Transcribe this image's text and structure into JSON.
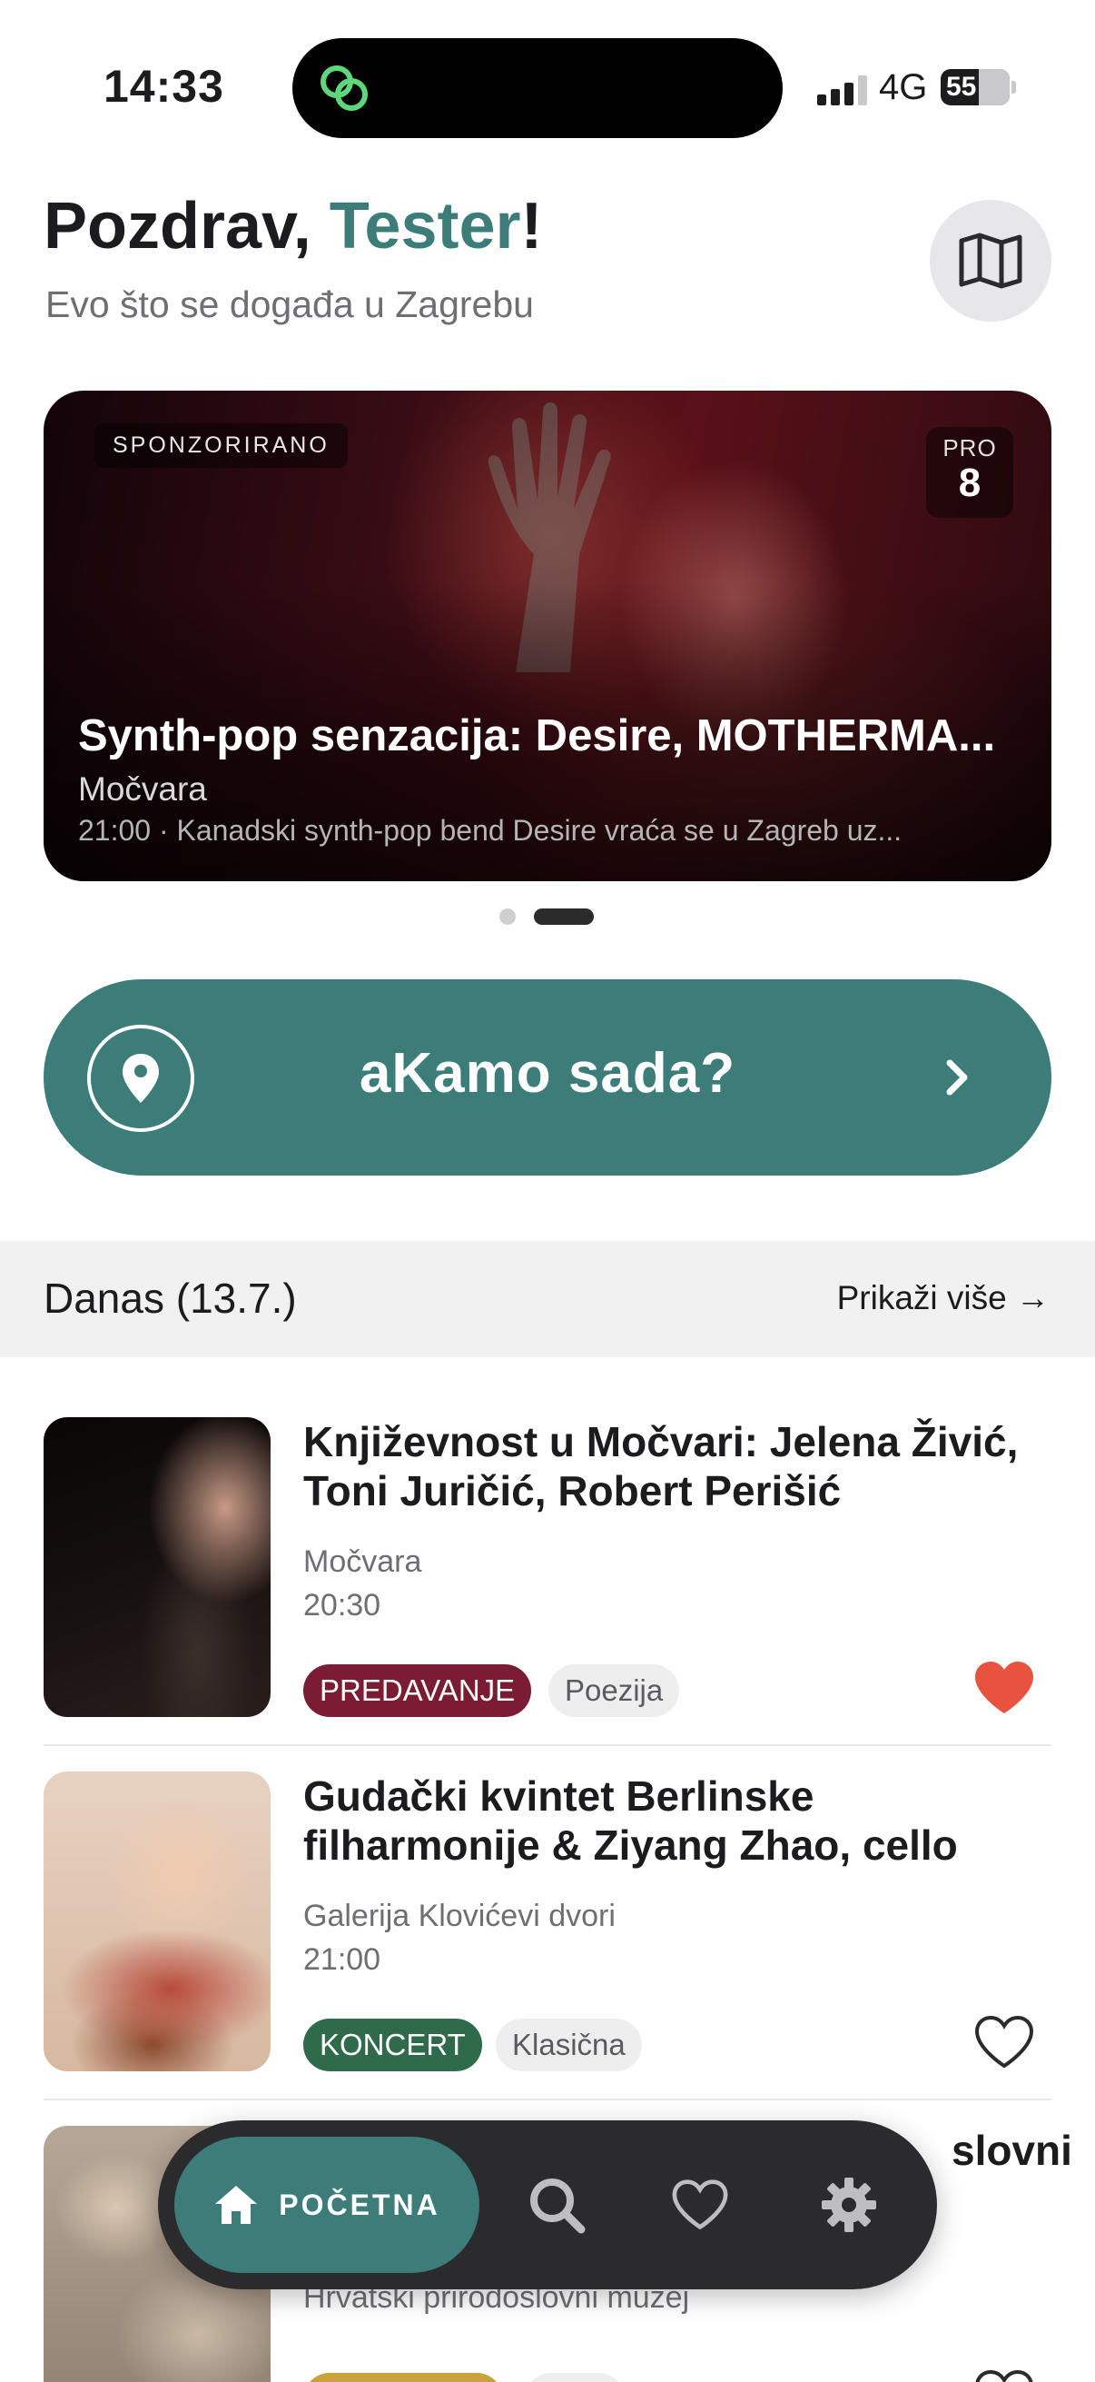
{
  "status_bar": {
    "time": "14:33",
    "network": "4G",
    "battery": "55"
  },
  "header": {
    "greeting_prefix": "Pozdrav, ",
    "user_name": "Tester",
    "greeting_suffix": "!",
    "subtitle": "Evo što se događa u Zagrebu",
    "map_icon": "map-icon"
  },
  "promo": {
    "tag": "SPONZORIRANO",
    "month": "PRO",
    "day": "8",
    "title": "Synth-pop senzacija: Desire, MOTHERMA...",
    "venue": "Močvara",
    "description": "21:00 · Kanadski synth-pop bend Desire vraća se u Zagreb uz...",
    "carousel": {
      "count": 2,
      "active": 2
    }
  },
  "cta": {
    "label": "aKamo  sada?",
    "icon": "location-pin-icon"
  },
  "section": {
    "title": "Danas (13.7.)",
    "more": "Prikaži više →"
  },
  "events": [
    {
      "title": "Književnost u Močvari: Jelena Živić, Toni Juričić, Robert Perišić",
      "venue": "Močvara",
      "time": "20:30",
      "type": "PREDAVANJE",
      "type_color": "#7c1c33",
      "genre": "Poezija",
      "favorite": true
    },
    {
      "title": "Gudački kvintet Berlinske filharmonije & Ziyang Zhao, cello",
      "venue": "Galerija Klovićevi dvori",
      "time": "21:00",
      "type": "KONCERT",
      "type_color": "#2f6b4a",
      "genre": "Klasična",
      "favorite": false
    },
    {
      "title_visible": "slovni",
      "venue": "Hrvatski prirodoslovni muzej",
      "type_color": "#c9a23a",
      "favorite": false
    }
  ],
  "nav": {
    "home_label": "POČETNA",
    "items": [
      "home-icon",
      "search-icon",
      "heart-icon",
      "gear-icon"
    ]
  },
  "colors": {
    "accent": "#3c7d7a",
    "favorite": "#e8533f",
    "tabbar": "#2b2b2d"
  }
}
